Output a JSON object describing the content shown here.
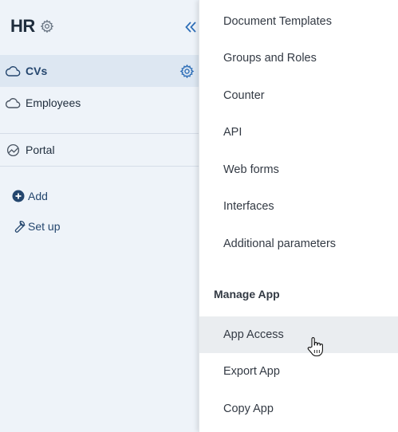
{
  "app": {
    "title": "HR"
  },
  "sidebar": {
    "items": [
      {
        "label": "CVs",
        "icon": "cloud-icon",
        "active": true
      },
      {
        "label": "Employees",
        "icon": "cloud-icon",
        "active": false
      },
      {
        "label": "Portal",
        "icon": "portal-icon",
        "active": false
      }
    ],
    "actions": [
      {
        "label": "Add",
        "icon": "plus-circle-icon"
      },
      {
        "label": "Set up",
        "icon": "wrench-icon"
      }
    ]
  },
  "menu": {
    "items": [
      {
        "label": "Document Templates"
      },
      {
        "label": "Groups and Roles"
      },
      {
        "label": "Counter"
      },
      {
        "label": "API"
      },
      {
        "label": "Web forms"
      },
      {
        "label": "Interfaces"
      },
      {
        "label": "Additional parameters"
      }
    ],
    "section_title": "Manage App",
    "section_items": [
      {
        "label": "App Access",
        "hovered": true
      },
      {
        "label": "Export App"
      },
      {
        "label": "Copy App"
      }
    ]
  },
  "colors": {
    "sidebar_bg": "#eef3f9",
    "active_bg": "#dde7f2",
    "accent": "#24466e",
    "menu_hover": "#eaedf0"
  }
}
